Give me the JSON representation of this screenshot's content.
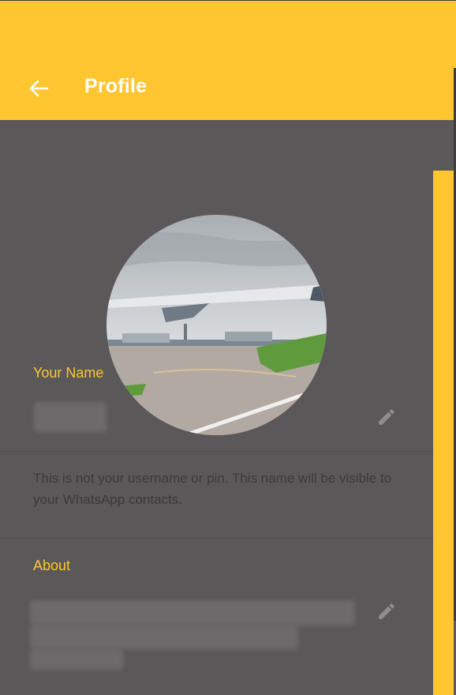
{
  "header": {
    "title": "Profile",
    "back_icon": "arrow-left-icon"
  },
  "name_section": {
    "label": "Your Name",
    "value_hidden": true,
    "edit_icon": "pencil-icon"
  },
  "hint": {
    "text": "This is not your username or pin. This name will be visible to your WhatsApp contacts."
  },
  "about_section": {
    "label": "About",
    "value_hidden": true,
    "edit_icon": "pencil-icon"
  },
  "colors": {
    "accent": "#ffc632",
    "background": "#5a5859",
    "hint_text": "#3b3a3a"
  }
}
